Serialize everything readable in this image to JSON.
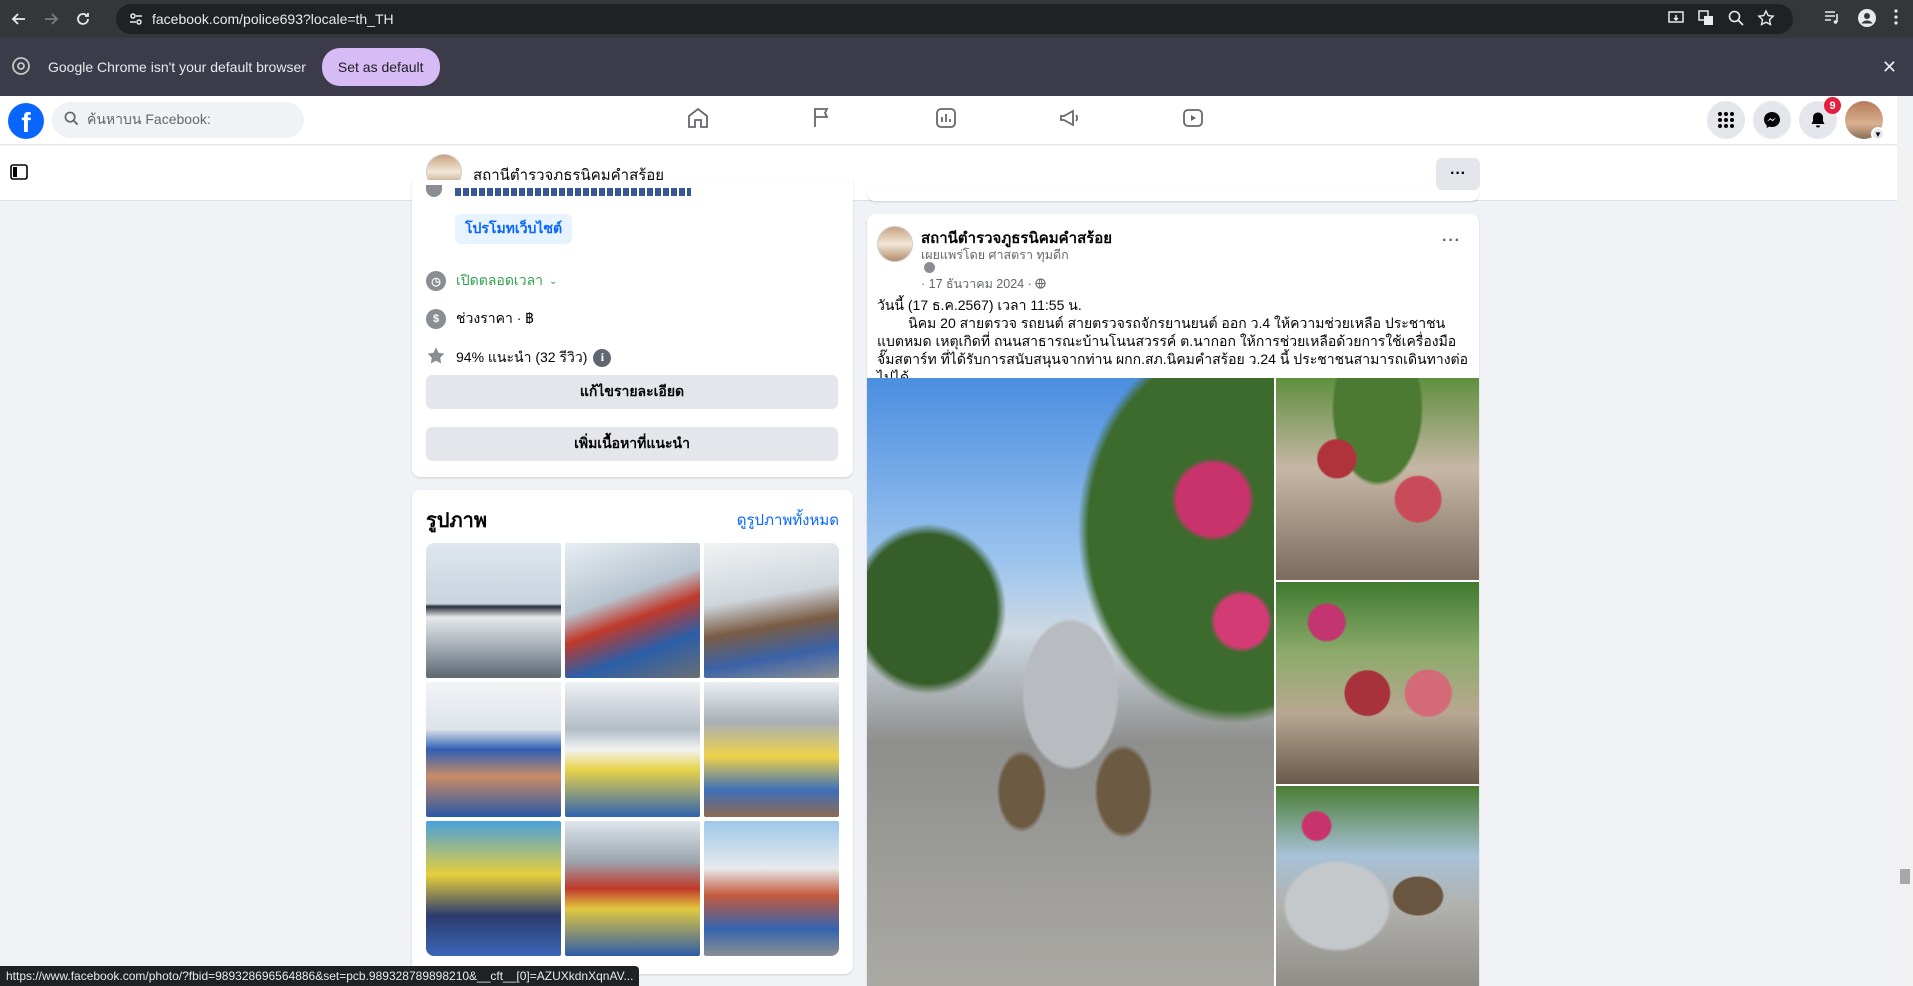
{
  "browser": {
    "url": "facebook.com/police693?locale=th_TH",
    "status_url": "https://www.facebook.com/photo/?fbid=989328696564886&set=pcb.989328789898210&__cft__[0]=AZUXkdnXqnAV..."
  },
  "infobar": {
    "message": "Google Chrome isn't your default browser",
    "button": "Set as default"
  },
  "header": {
    "logo": "f",
    "search_placeholder": "ค้นหาบน Facebook:",
    "notification_count": "9"
  },
  "page": {
    "name": "สถานีตำรวจภูธรนิคมคำสร้อย"
  },
  "intro": {
    "promote_label": "โปรโมทเว็บไซต์",
    "hours": "เปิดตลอดเวลา",
    "price": "ช่วงราคา · ฿",
    "rating": "94% แนะนำ (32 รีวิว)",
    "edit_button": "แก้ไขรายละเอียด",
    "add_button": "เพิ่มเนื้อหาที่แนะนำ"
  },
  "photos": {
    "title": "รูปภาพ",
    "see_all": "ดูรูปภาพทั้งหมด"
  },
  "post": {
    "author": "สถานีตำรวจภูธรนิคมคำสร้อย",
    "published_by": "เผยแพร่โดย ศาสตรา ทุมดีก",
    "date": "· 17 ธันวาคม 2024 ·",
    "line1": "วันนี้ (17 ธ.ค.2567) เวลา 11:55 น.",
    "body": "        นิคม 20 สายตรวจ รถยนต์ สายตรวจรถจักรยานยนต์ ออก ว.4 ให้ความช่วยเหลือ ประชาชนแบตหมด เหตุเกิดที่ ถนนสาธารณะบ้านโนนสวรรค์ ต.นากอก ให้การช่วยเหลือด้วยการใช้เครื่องมือจั๊มสตาร์ท ที่ได้รับการสนับสนุนจากท่าน ผกก.สภ.นิคมคำสร้อย ว.24 นี้ ประชาชนสามารถเดินทางต่อไปได้"
  },
  "colors": {
    "facebook_blue": "#0866ff",
    "chrome_dark": "#35363a",
    "infobar": "#3c3b49",
    "set_default_button": "#d7bbf5",
    "open_green": "#31a24c",
    "badge_red": "#e41e3f"
  }
}
